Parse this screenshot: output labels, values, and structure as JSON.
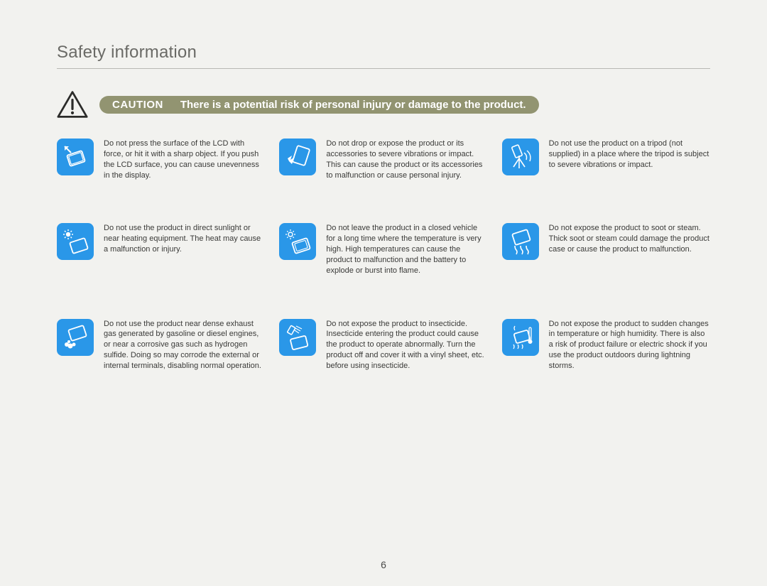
{
  "page": {
    "title": "Safety information",
    "page_number": "6"
  },
  "caution": {
    "label": "CAUTION",
    "text": "There is a potential risk of personal injury or damage to the product."
  },
  "items": [
    {
      "icon": "lcd-press",
      "text": "Do not press the surface of the LCD with force, or hit it with a sharp object. If you push the LCD surface, you can cause unevenness in the display."
    },
    {
      "icon": "drop-impact",
      "text": "Do not drop or expose the product or its accessories to severe vibrations or impact. This can cause the product or its accessories to malfunction or cause personal injury."
    },
    {
      "icon": "tripod",
      "text": "Do not use the product on a tripod (not supplied) in a place where the tripod is subject to severe vibrations or impact."
    },
    {
      "icon": "sun-heat",
      "text": "Do not use the product in direct sunlight or near heating equipment. The heat may cause a malfunction or injury."
    },
    {
      "icon": "hot-car",
      "text": "Do not leave the product in a closed vehicle for a long time where the temperature is very high. High temperatures can cause the product to malfunction and the battery to explode or burst into flame."
    },
    {
      "icon": "steam",
      "text": "Do not expose the product to soot or steam. Thick soot or steam could damage the product case or cause the product to malfunction."
    },
    {
      "icon": "exhaust-gas",
      "text": "Do not use the product near dense exhaust gas generated by gasoline or diesel engines, or near a corrosive gas such as hydrogen sulfide. Doing so may corrode the external or internal terminals, disabling normal operation."
    },
    {
      "icon": "insecticide",
      "text": "Do not expose the product to insecticide. Insecticide entering the product could cause the product to operate abnormally. Turn the product off and cover it with a vinyl sheet, etc. before using insecticide."
    },
    {
      "icon": "temp-humidity",
      "text": "Do not expose the product to sudden changes in temperature or high humidity. There is also a risk of product failure or electric shock if you use the product outdoors during lightning storms."
    }
  ]
}
